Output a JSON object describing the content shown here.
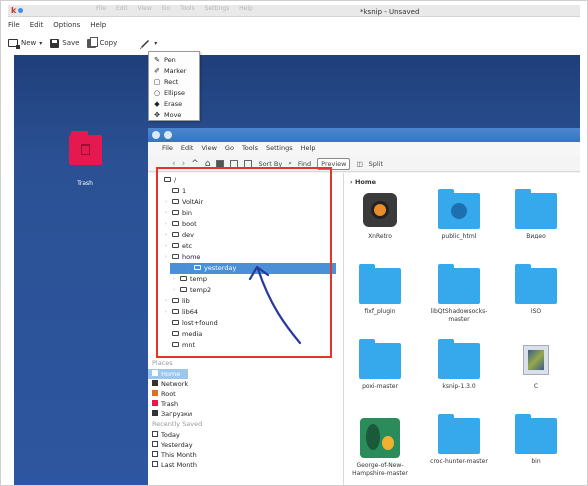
{
  "window": {
    "title": "*ksnip - Unsaved",
    "ghost_menu": [
      "File",
      "Edit",
      "View",
      "Go",
      "Tools",
      "Settings",
      "Help"
    ]
  },
  "menubar": [
    "File",
    "Edit",
    "Options",
    "Help"
  ],
  "toolbar": {
    "new_label": "New",
    "save_label": "Save",
    "copy_label": "Copy"
  },
  "tool_menu": {
    "items": [
      "Pen",
      "Marker",
      "Rect",
      "Ellipse",
      "Erase",
      "Move"
    ]
  },
  "desktop": {
    "trash_label": "Trash"
  },
  "file_manager": {
    "menubar": [
      "File",
      "Edit",
      "View",
      "Go",
      "Tools",
      "Settings",
      "Help"
    ],
    "toolbar": {
      "sort_label": "Sort By",
      "find_label": "Find",
      "preview_label": "Preview",
      "split_label": "Split"
    },
    "tree": [
      {
        "label": "/",
        "expandable": false,
        "indent": 0
      },
      {
        "label": "1",
        "expandable": false,
        "indent": 1
      },
      {
        "label": "VoltAir",
        "expandable": true,
        "indent": 1
      },
      {
        "label": "bin",
        "expandable": true,
        "indent": 1
      },
      {
        "label": "boot",
        "expandable": true,
        "indent": 1
      },
      {
        "label": "dev",
        "expandable": true,
        "indent": 1
      },
      {
        "label": "etc",
        "expandable": true,
        "indent": 1
      },
      {
        "label": "home",
        "expandable": true,
        "indent": 1
      },
      {
        "label": "yesterday",
        "expandable": true,
        "indent": 2,
        "selected": true
      },
      {
        "label": "temp",
        "expandable": true,
        "indent": 2
      },
      {
        "label": "temp2",
        "expandable": true,
        "indent": 2
      },
      {
        "label": "lib",
        "expandable": true,
        "indent": 1
      },
      {
        "label": "lib64",
        "expandable": true,
        "indent": 1
      },
      {
        "label": "lost+found",
        "expandable": false,
        "indent": 1
      },
      {
        "label": "media",
        "expandable": false,
        "indent": 1
      },
      {
        "label": "mnt",
        "expandable": false,
        "indent": 1
      }
    ],
    "places_label": "Places",
    "places": [
      {
        "label": "Home",
        "selected": true,
        "color": "#4a90d9"
      },
      {
        "label": "Network",
        "color": "#333333"
      },
      {
        "label": "Root",
        "color": "#e07020"
      },
      {
        "label": "Trash",
        "color": "#e5194f"
      },
      {
        "label": "Загрузки",
        "color": "#333333"
      }
    ],
    "recent_label": "Recently Saved",
    "recent": [
      {
        "label": "Today"
      },
      {
        "label": "Yesterday"
      },
      {
        "label": "This Month"
      },
      {
        "label": "Last Month"
      }
    ],
    "breadcrumb": "Home",
    "items": [
      {
        "label": "XnRetro",
        "kind": "app"
      },
      {
        "label": "public_html",
        "kind": "folder-globe"
      },
      {
        "label": "Видео",
        "kind": "folder"
      },
      {
        "label": "fixf_plugin",
        "kind": "folder"
      },
      {
        "label": "libQtShadowsocks-master",
        "kind": "folder"
      },
      {
        "label": "ISO",
        "kind": "folder"
      },
      {
        "label": "poxi-master",
        "kind": "folder"
      },
      {
        "label": "ksnip-1.3.0",
        "kind": "folder"
      },
      {
        "label": "C",
        "kind": "image"
      },
      {
        "label": "George-of-New-Hampshire-master",
        "kind": "george"
      },
      {
        "label": "croc-hunter-master",
        "kind": "folder"
      },
      {
        "label": "bin",
        "kind": "folder"
      }
    ]
  },
  "colors": {
    "highlight_rect": "#e5342a",
    "arrow": "#2a3a9a",
    "folder_blue": "#36a8ec",
    "selection": "#4a90d9"
  }
}
